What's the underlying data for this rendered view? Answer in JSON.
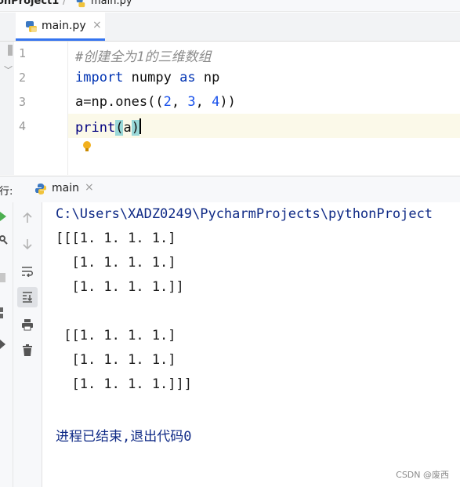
{
  "breadcrumb": {
    "project": "onProject1",
    "file": "main.py"
  },
  "editor": {
    "tab": {
      "label": "main.py",
      "close": "×"
    },
    "lines": [
      {
        "number": "1",
        "comment": "#创建全为1的三维数组"
      },
      {
        "number": "2",
        "keyword_import": "import",
        "module": "numpy",
        "keyword_as": "as",
        "alias": "np"
      },
      {
        "number": "3",
        "var": "a",
        "op": "=",
        "call": "np.ones((",
        "n1": "2",
        "n2": "3",
        "n3": "4",
        "tail": "))"
      },
      {
        "number": "4",
        "fn": "print",
        "open": "(",
        "arg": "a",
        "close": ")"
      }
    ]
  },
  "run": {
    "label": "行:",
    "tab": {
      "name": "main",
      "close": "×"
    }
  },
  "console": {
    "path": "C:\\Users\\XADZ0249\\PycharmProjects\\pythonProject",
    "output": [
      "[[[1. 1. 1. 1.]",
      "  [1. 1. 1. 1.]",
      "  [1. 1. 1. 1.]]",
      "",
      " [[1. 1. 1. 1.]",
      "  [1. 1. 1. 1.]",
      "  [1. 1. 1. 1.]]]"
    ],
    "exit_message": "进程已结束,退出代码0"
  },
  "watermark": "CSDN @废西",
  "colors": {
    "keyword": "#0033b3",
    "number": "#1750eb",
    "comment": "#8c8c8c",
    "tab_accent": "#3574f0",
    "console_path": "#0f2a86"
  }
}
